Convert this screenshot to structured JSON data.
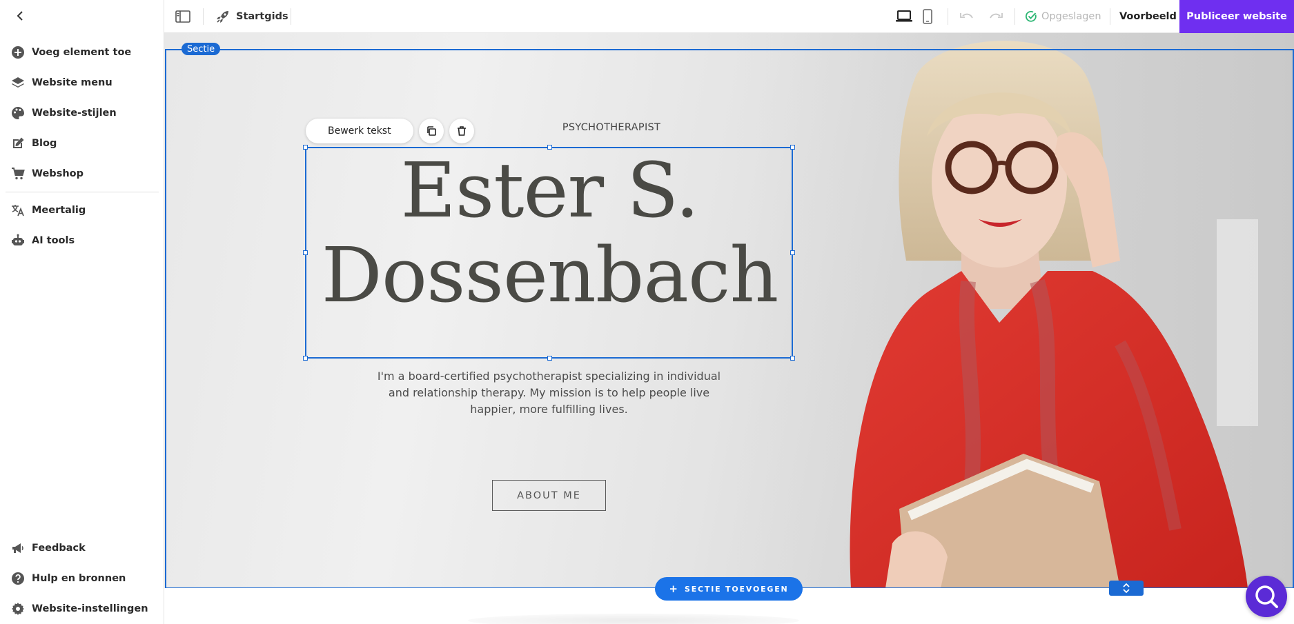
{
  "sidebar": {
    "items": [
      {
        "label": "Voeg element toe",
        "icon": "plus-circle-icon"
      },
      {
        "label": "Website menu",
        "icon": "layers-icon"
      },
      {
        "label": "Website-stijlen",
        "icon": "palette-icon"
      },
      {
        "label": "Blog",
        "icon": "edit-icon"
      },
      {
        "label": "Webshop",
        "icon": "cart-icon"
      },
      {
        "label": "Meertalig",
        "icon": "translate-icon"
      },
      {
        "label": "AI tools",
        "icon": "robot-icon"
      }
    ],
    "bottom_items": [
      {
        "label": "Feedback",
        "icon": "megaphone-icon"
      },
      {
        "label": "Hulp en bronnen",
        "icon": "help-icon"
      },
      {
        "label": "Website-instellingen",
        "icon": "gear-icon"
      }
    ]
  },
  "topbar": {
    "guide_label": "Startgids",
    "saved_label": "Opgeslagen",
    "preview_label": "Voorbeeld",
    "publish_label": "Publiceer website"
  },
  "editor": {
    "section_badge": "Sectie",
    "edit_text_label": "Bewerk tekst",
    "add_section_label": "SECTIE TOEVOEGEN"
  },
  "hero": {
    "tagline": "PSYCHOTHERAPIST",
    "headline_line1": "Ester S.",
    "headline_line2": "Dossenbach",
    "description": "I'm a board-certified psychotherapist specializing in individual and relationship therapy. My mission is to help people live happier, more fulfilling lives.",
    "button_label": "ABOUT ME"
  },
  "colors": {
    "accent": "#1b6ad3",
    "publish": "#6f2ff0",
    "help_bubble": "#5b2bd6"
  }
}
